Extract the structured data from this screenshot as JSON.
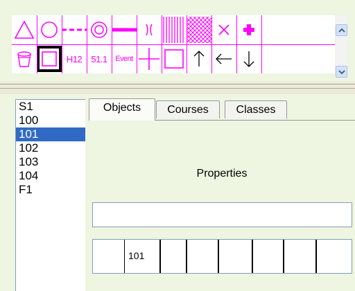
{
  "palette": {
    "accent_color": "#ff00ff",
    "row1": [
      {
        "name": "triangle-icon"
      },
      {
        "name": "circle-icon"
      },
      {
        "name": "dashed-line-icon"
      },
      {
        "name": "double-circle-icon"
      },
      {
        "name": "thick-line-icon"
      },
      {
        "name": "bracket-crossing-icon"
      },
      {
        "name": "vertical-hatch-icon"
      },
      {
        "name": "crosshatch-icon"
      },
      {
        "name": "x-mark-icon"
      },
      {
        "name": "plus-filled-icon"
      }
    ],
    "row2": [
      {
        "name": "cup-icon"
      },
      {
        "name": "square-icon",
        "selected": true
      },
      {
        "name": "label-h12",
        "text": "H12"
      },
      {
        "name": "label-51-1",
        "text": "51.1"
      },
      {
        "name": "label-event",
        "text": "Event"
      },
      {
        "name": "plus-thin-icon"
      },
      {
        "name": "square-outline-icon"
      },
      {
        "name": "arrow-up-icon"
      },
      {
        "name": "arrow-left-icon"
      },
      {
        "name": "arrow-down-icon"
      }
    ]
  },
  "course_list": {
    "items": [
      "S1",
      "100",
      "101",
      "102",
      "103",
      "104",
      "F1"
    ],
    "selected": "101"
  },
  "tabs": {
    "items": [
      "Objects",
      "Courses",
      "Classes"
    ],
    "active": "Objects"
  },
  "panel": {
    "properties_label": "Properties",
    "property_value": "",
    "grid_values": [
      "",
      "101",
      "",
      "",
      "",
      "",
      "",
      ""
    ]
  }
}
